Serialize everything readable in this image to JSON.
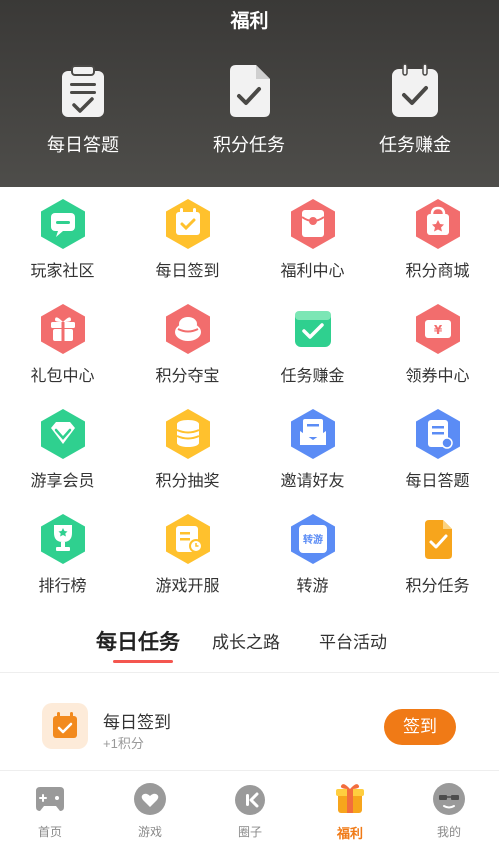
{
  "header": {
    "title": "福利",
    "items": [
      {
        "label": "每日答题",
        "icon": "quiz-icon"
      },
      {
        "label": "积分任务",
        "icon": "task-doc-icon"
      },
      {
        "label": "任务赚金",
        "icon": "clipboard-check-icon"
      }
    ]
  },
  "grid": [
    {
      "label": "玩家社区",
      "icon": "community-icon",
      "color": "#2fd08f"
    },
    {
      "label": "每日签到",
      "icon": "calendar-check-icon",
      "color": "#ffc12d"
    },
    {
      "label": "福利中心",
      "icon": "red-envelope-icon",
      "color": "#f26d6d"
    },
    {
      "label": "积分商城",
      "icon": "shop-bag-icon",
      "color": "#f26d6d"
    },
    {
      "label": "礼包中心",
      "icon": "gift-icon",
      "color": "#f26d6d"
    },
    {
      "label": "积分夺宝",
      "icon": "treasure-icon",
      "color": "#f26d6d"
    },
    {
      "label": "任务赚金",
      "icon": "task-check-icon",
      "color": "#2fd08f"
    },
    {
      "label": "领券中心",
      "icon": "coupon-icon",
      "color": "#f26d6d"
    },
    {
      "label": "游享会员",
      "icon": "vip-diamond-icon",
      "color": "#2fd08f"
    },
    {
      "label": "积分抽奖",
      "icon": "coin-stack-icon",
      "color": "#ffc12d"
    },
    {
      "label": "邀请好友",
      "icon": "invite-mail-icon",
      "color": "#5b8cf5"
    },
    {
      "label": "每日答题",
      "icon": "quiz-doc-icon",
      "color": "#5b8cf5"
    },
    {
      "label": "排行榜",
      "icon": "trophy-icon",
      "color": "#2fd08f"
    },
    {
      "label": "游戏开服",
      "icon": "server-clock-icon",
      "color": "#ffc12d"
    },
    {
      "label": "转游",
      "icon": "transfer-game-icon",
      "color": "#5b8cf5"
    },
    {
      "label": "积分任务",
      "icon": "points-task-icon",
      "color": "#f7a51c"
    }
  ],
  "tabs": [
    {
      "label": "每日任务",
      "active": true
    },
    {
      "label": "成长之路",
      "active": false
    },
    {
      "label": "平台活动",
      "active": false
    }
  ],
  "task": {
    "name": "每日签到",
    "reward": "+1积分",
    "button": "签到"
  },
  "tabbar": [
    {
      "label": "首页",
      "icon": "gamepad-home-icon",
      "active": false
    },
    {
      "label": "游戏",
      "icon": "game-heart-icon",
      "active": false
    },
    {
      "label": "圈子",
      "icon": "circle-chat-icon",
      "active": false
    },
    {
      "label": "福利",
      "icon": "gift-box-icon",
      "active": true
    },
    {
      "label": "我的",
      "icon": "avatar-glasses-icon",
      "active": false
    }
  ],
  "colors": {
    "accent": "#f07a16",
    "tab_underline": "#f4564f",
    "header_bg": "#3f3e3b"
  }
}
